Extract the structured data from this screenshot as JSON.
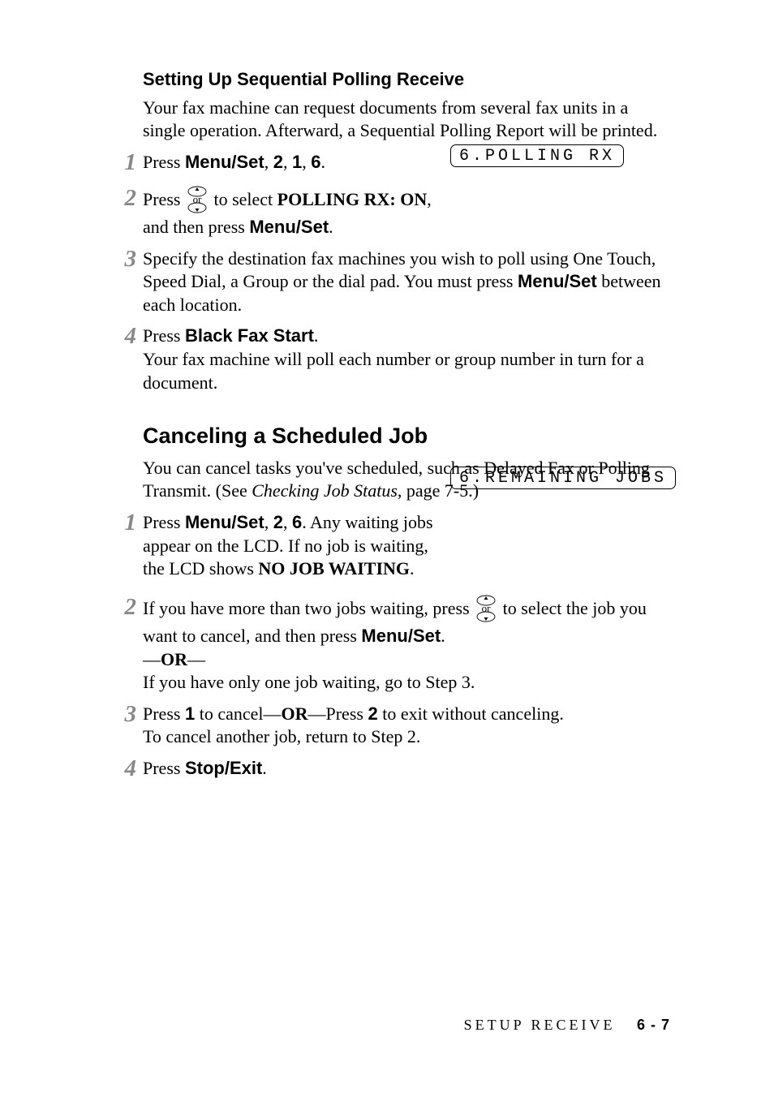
{
  "section1": {
    "heading": "Setting Up Sequential Polling Receive",
    "intro": "Your fax machine can request documents from several fax units in a single operation. Afterward, a Sequential Polling Report will be printed.",
    "steps": {
      "s1": {
        "num": "1",
        "press": "Press ",
        "menuSet": "Menu/Set",
        "comma1": ", ",
        "d2": "2",
        "comma2": ", ",
        "d1": "1",
        "comma3": ", ",
        "d6": "6",
        "period": "."
      },
      "s2": {
        "num": "2",
        "press": "Press ",
        "toSelect": " to select ",
        "pollingRx": "POLLING RX: ON",
        "comma": ",",
        "andThen": "and then press ",
        "menuSet": "Menu/Set",
        "period": "."
      },
      "s3": {
        "num": "3",
        "text1": "Specify the destination fax machines you wish to poll using One Touch, Speed Dial, a Group or the dial pad. You must press ",
        "menuSet": "Menu/Set",
        "text2": " between each location."
      },
      "s4": {
        "num": "4",
        "press": "Press ",
        "blackFaxStart": "Black Fax Start",
        "period": ".",
        "follow": "Your fax machine will poll each number or group number in turn for a document."
      }
    },
    "lcd": "6.POLLING RX"
  },
  "section2": {
    "heading": "Canceling a Scheduled Job",
    "intro1": "You can cancel tasks you've scheduled, such as Delayed Fax or Polling Transmit. (See ",
    "introItalic": "Checking Job Status",
    "intro2": ", page 7-5.)",
    "steps": {
      "s1": {
        "num": "1",
        "press": "Press ",
        "menuSet": "Menu/Set",
        "comma1": ", ",
        "d2": "2",
        "comma2": ", ",
        "d6": "6",
        "text1": ". Any waiting jobs appear on the LCD. If no job is waiting, the LCD shows ",
        "noJob": "NO JOB WAITING",
        "period": "."
      },
      "s2": {
        "num": "2",
        "text1": "If you have more than two jobs waiting, press ",
        "text2": " to select the job you want to cancel, and then press ",
        "menuSet": "Menu/Set",
        "period": ".",
        "dashOR": "—",
        "OR": "OR",
        "dash2": "—",
        "text3": "If you have only one job waiting, go to Step 3."
      },
      "s3": {
        "num": "3",
        "press": "Press ",
        "d1": "1",
        "toCancel": " to cancel—",
        "OR": "OR",
        "dashPress": "—Press ",
        "d2": "2",
        "toExit": " to exit without canceling.",
        "line2": "To cancel another job, return to Step 2."
      },
      "s4": {
        "num": "4",
        "press": "Press ",
        "stopExit": "Stop/Exit",
        "period": "."
      }
    },
    "lcd": "6.REMAINING JOBS"
  },
  "footer": {
    "section": "SETUP RECEIVE",
    "page": "6 - 7"
  },
  "icons": {
    "arrowKey": "or"
  }
}
